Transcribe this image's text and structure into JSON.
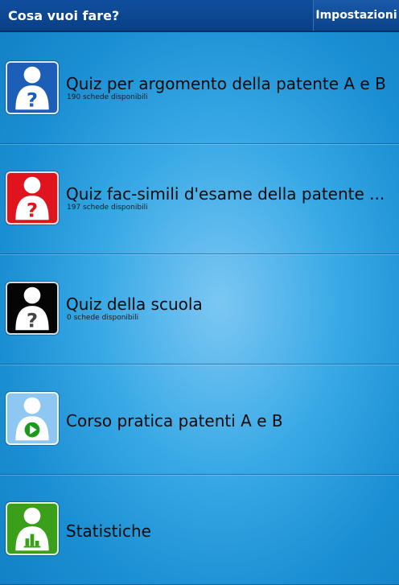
{
  "header": {
    "title": "Cosa vuoi fare?",
    "settings_label": "Impostazioni"
  },
  "items": [
    {
      "label": "Quiz per argomento della patente A e B",
      "subtitle": "190 schede disponibili",
      "icon": "user-question-icon",
      "color": "#1d5fb8"
    },
    {
      "label": "Quiz fac-simili d'esame della patente ...",
      "subtitle": "197 schede disponibili",
      "icon": "user-question-icon",
      "color": "#e0141c"
    },
    {
      "label": "Quiz della scuola",
      "subtitle": "0 schede disponibili",
      "icon": "user-question-icon",
      "color": "#050505"
    },
    {
      "label": "Corso pratica patenti A e B",
      "subtitle": "",
      "icon": "user-play-icon",
      "color": "#8ec8f2"
    },
    {
      "label": "Statistiche",
      "subtitle": "",
      "icon": "user-chart-icon",
      "color": "#3aa019"
    }
  ]
}
